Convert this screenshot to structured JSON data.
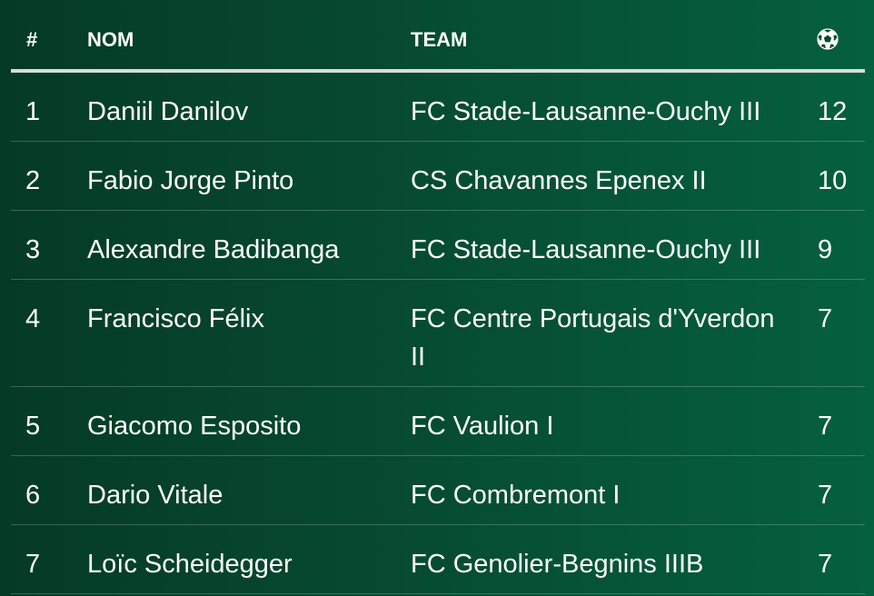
{
  "header": {
    "rank": "#",
    "name": "NOM",
    "team": "TEAM",
    "goals_icon": "soccer-ball-icon"
  },
  "rows": [
    {
      "rank": "1",
      "name": "Daniil Danilov",
      "team": "FC Stade-Lausanne-Ouchy III",
      "goals": "12"
    },
    {
      "rank": "2",
      "name": "Fabio Jorge Pinto",
      "team": "CS Chavannes Epenex II",
      "goals": "10"
    },
    {
      "rank": "3",
      "name": "Alexandre Badibanga",
      "team": "FC Stade-Lausanne-Ouchy III",
      "goals": "9"
    },
    {
      "rank": "4",
      "name": "Francisco Félix",
      "team": "FC Centre Portugais d'Yverdon II",
      "goals": "7"
    },
    {
      "rank": "5",
      "name": "Giacomo Esposito",
      "team": "FC Vaulion I",
      "goals": "7"
    },
    {
      "rank": "6",
      "name": "Dario Vitale",
      "team": "FC Combremont I",
      "goals": "7"
    },
    {
      "rank": "7",
      "name": "Loïc Scheidegger",
      "team": "FC Genolier-Begnins IIIB",
      "goals": "7"
    }
  ],
  "colors": {
    "background_start": "#053a26",
    "background_end": "#05603f",
    "header_rule": "#d9dcda",
    "text": "#ffffff"
  }
}
